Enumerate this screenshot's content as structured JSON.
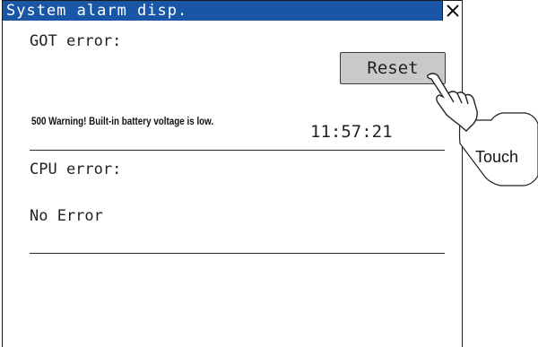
{
  "window": {
    "title": "System alarm disp.",
    "close_icon": "close-icon"
  },
  "got_section": {
    "label": "GOT error:",
    "reset_label": "Reset",
    "message": "500 Warning! Built-in battery voltage is low.",
    "time": "11:57:21"
  },
  "cpu_section": {
    "label": "CPU error:",
    "status": "No Error"
  },
  "callout": {
    "text": "Touch",
    "icon": "pointing-hand-icon"
  },
  "colors": {
    "titlebar": "#1a56a6",
    "button": "#c9c9c9"
  }
}
